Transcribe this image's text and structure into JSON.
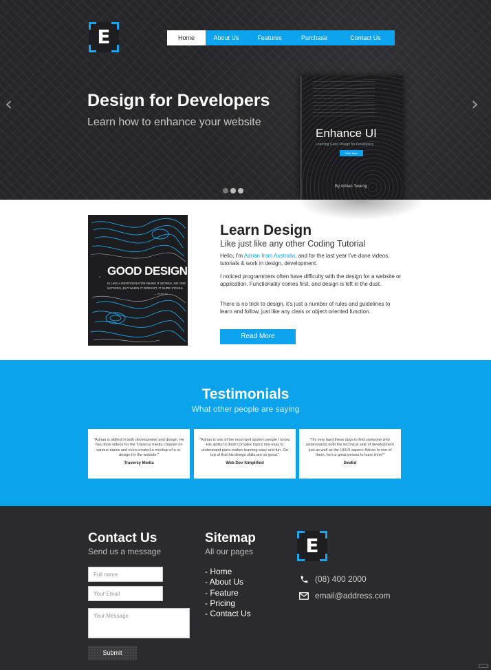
{
  "brand": {
    "logo_letter": "E"
  },
  "nav": {
    "items": [
      {
        "label": "Home",
        "active": true
      },
      {
        "label": "About Us",
        "active": false
      },
      {
        "label": "Features",
        "active": false
      },
      {
        "label": "Purchase",
        "active": false
      },
      {
        "label": "Contact Us",
        "active": false
      }
    ]
  },
  "hero": {
    "title": "Design for Developers",
    "subtitle": "Learn how to enhance your website",
    "book": {
      "title": "Enhance UI",
      "subtitle": "Learning Good Design for Developers",
      "button": "Start Now",
      "author": "By Adrian Twarog"
    },
    "carousel_dots": 3,
    "active_dot": 0
  },
  "learn": {
    "title": "Learn Design",
    "subtitle": "Like just like any other Coding Tutorial",
    "p1_before": "Hello, I'm ",
    "p1_link": "Adrian from Australia",
    "p1_after": ", and for the last year I've done videos, tutorials & work in design, development.",
    "p2": "I noticed programmers often have difficulty with the design for a website or application. Functionality comes first, and design is left in the dust.",
    "p3": "There is no trick to design, it's just a number of rules and guidelines to learn and follow, just like any class or object oriented function.",
    "button": "Read More",
    "poster": {
      "title": "GOOD DESIGN",
      "quote": "IS LIKE A REFRIGERATOR WHEN IT WORKS, NO ONE NOTICES, BUT WHEN IT DOESN'T, IT SURE STINKS.",
      "attribution": "— Irene Au"
    }
  },
  "testimonials": {
    "title": "Testimonials",
    "subtitle": "What other people are saying",
    "items": [
      {
        "quote": "\"Adrian is skilled in both development and design. He has done videos for the Traversy media channel on various topics and even created a mockup of a re-design for the website.\"",
        "author": "Traversy Media"
      },
      {
        "quote": "\"Adrian is one of the most well spoken people I know. His ability to distill complex topics into easy to understand parts makes learning easy and fun. On top of that his design skills are so good.\"",
        "author": "Web Dev Simplified"
      },
      {
        "quote": "\"It's very hard these days to find someone who understands both the technical side of development just as well as the UI/UX aspect. Adrian is one of them, he's a great person to learn from!\"",
        "author": "DevEd"
      }
    ]
  },
  "contact": {
    "title": "Contact Us",
    "subtitle": "Send us a message",
    "name_placeholder": "Full name",
    "email_placeholder": "Your Email",
    "message_placeholder": "Your Message",
    "submit": "Submit"
  },
  "sitemap": {
    "title": "Sitemap",
    "subtitle": "All our pages",
    "links": [
      "- Home",
      "- About Us",
      "- Feature",
      "- Pricing",
      "- Contact Us"
    ]
  },
  "info": {
    "phone": "(08) 400 2000",
    "email": "email@address.com"
  },
  "colors": {
    "accent": "#0ea3ee",
    "dark": "#2b2b2d",
    "hero_bg": "#262628"
  }
}
